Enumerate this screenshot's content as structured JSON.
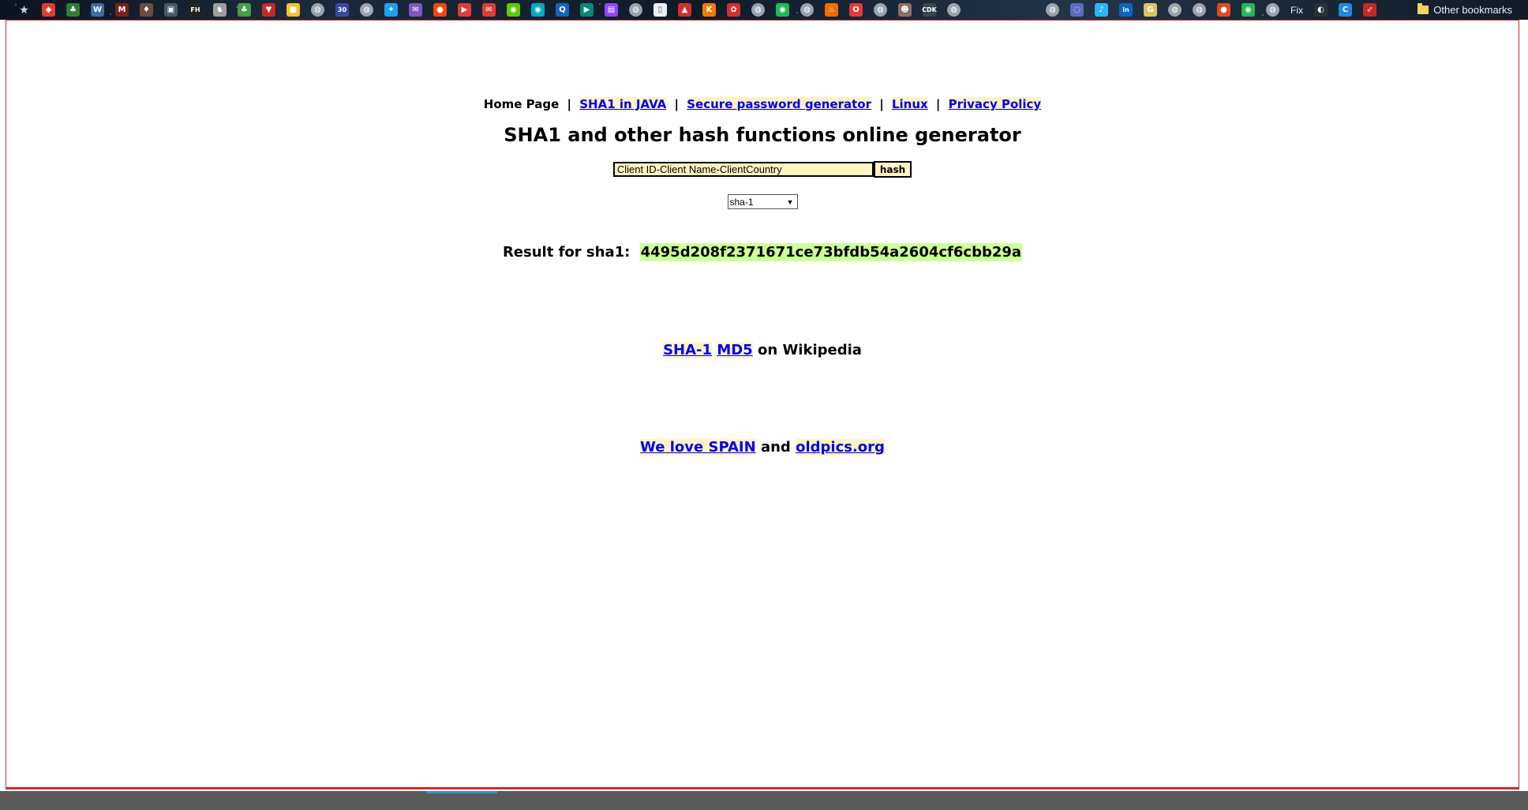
{
  "bookmarks_bar": {
    "icons": [
      {
        "name": "bookmark-star-icon",
        "color": "#cfd6df",
        "glyph": "★"
      },
      {
        "name": "pill-icon",
        "color": "#e53935",
        "glyph": "◆"
      },
      {
        "name": "clover-icon",
        "color": "#2e7d32",
        "glyph": "♣"
      },
      {
        "name": "wordpress-icon",
        "color": "#3b6ea5",
        "glyph": "W"
      },
      {
        "name": "mx-icon",
        "color": "#7b1f1f",
        "glyph": "M"
      },
      {
        "name": "fire-icon",
        "color": "#6d4c41",
        "glyph": "♦"
      },
      {
        "name": "book-icon",
        "color": "#455a64",
        "glyph": "▣"
      },
      {
        "name": "fh-icon",
        "color": "#222",
        "glyph": "FH"
      },
      {
        "name": "horse-icon",
        "color": "#9e9e9e",
        "glyph": "♞"
      },
      {
        "name": "leaf-icon",
        "color": "#43a047",
        "glyph": "♣"
      },
      {
        "name": "shield-icon",
        "color": "#c62828",
        "glyph": "▼"
      },
      {
        "name": "notes-icon",
        "color": "#fbc02d",
        "glyph": "■"
      },
      {
        "name": "globe-icon",
        "color": "#9aa3ad",
        "glyph": "◍"
      },
      {
        "name": "calendar-icon",
        "color": "#3949ab",
        "glyph": "30"
      },
      {
        "name": "globe-icon",
        "color": "#9aa3ad",
        "glyph": "◍"
      },
      {
        "name": "twitter-icon",
        "color": "#1da1f2",
        "glyph": "✦"
      },
      {
        "name": "messenger-icon",
        "color": "#7e57c2",
        "glyph": "✉"
      },
      {
        "name": "reddit-icon",
        "color": "#ff4500",
        "glyph": "●"
      },
      {
        "name": "youtube-icon",
        "color": "#e53935",
        "glyph": "▶"
      },
      {
        "name": "mail-icon",
        "color": "#e53935",
        "glyph": "✉"
      },
      {
        "name": "duolingo-icon",
        "color": "#58cc02",
        "glyph": "◉"
      },
      {
        "name": "app-icon",
        "color": "#00acc1",
        "glyph": "◉"
      },
      {
        "name": "quora-icon",
        "color": "#1565c0",
        "glyph": "Q"
      },
      {
        "name": "play-icon",
        "color": "#00897b",
        "glyph": "▶"
      },
      {
        "name": "twitch-icon",
        "color": "#9146ff",
        "glyph": "▤"
      },
      {
        "name": "globe-icon",
        "color": "#9aa3ad",
        "glyph": "◍"
      },
      {
        "name": "page-icon",
        "color": "#eceff1",
        "glyph": "▯"
      },
      {
        "name": "triangle-icon",
        "color": "#d32f2f",
        "glyph": "▲"
      },
      {
        "name": "k-icon",
        "color": "#f57c00",
        "glyph": "K"
      },
      {
        "name": "huawei-icon",
        "color": "#d32f2f",
        "glyph": "✿"
      },
      {
        "name": "globe-icon",
        "color": "#9aa3ad",
        "glyph": "◍"
      },
      {
        "name": "spotify-icon",
        "color": "#1db954",
        "glyph": "◉"
      },
      {
        "name": "globe-icon",
        "color": "#9aa3ad",
        "glyph": "◍"
      },
      {
        "name": "flame-icon",
        "color": "#ef6c00",
        "glyph": "♨"
      },
      {
        "name": "opera-icon",
        "color": "#e53935",
        "glyph": "O"
      },
      {
        "name": "globe-icon",
        "color": "#9aa3ad",
        "glyph": "◍"
      },
      {
        "name": "avatar-icon",
        "color": "#8d6e63",
        "glyph": "☻"
      },
      {
        "name": "cdk-icon",
        "color": "#37474f",
        "glyph": "CDK"
      },
      {
        "name": "globe-icon",
        "color": "#9aa3ad",
        "glyph": "◍"
      }
    ],
    "icons_right": [
      {
        "name": "globe-icon",
        "color": "#9aa3ad",
        "glyph": "◍"
      },
      {
        "name": "loop-icon",
        "color": "#5c6bc0",
        "glyph": "◌"
      },
      {
        "name": "music-icon",
        "color": "#29b6f6",
        "glyph": "♪"
      },
      {
        "name": "linkedin-icon",
        "color": "#0a66c2",
        "glyph": "in"
      },
      {
        "name": "g-icon",
        "color": "#e0c060",
        "glyph": "G"
      },
      {
        "name": "globe-icon",
        "color": "#9aa3ad",
        "glyph": "◍"
      },
      {
        "name": "globe-icon",
        "color": "#9aa3ad",
        "glyph": "◍"
      },
      {
        "name": "apple-icon",
        "color": "#e64a19",
        "glyph": "●"
      },
      {
        "name": "spotify-icon",
        "color": "#1db954",
        "glyph": "◉"
      },
      {
        "name": "globe-icon",
        "color": "#9aa3ad",
        "glyph": "◍"
      }
    ],
    "fix_label": "Fix",
    "icons_far_right": [
      {
        "name": "dark-icon",
        "color": "#263238",
        "glyph": "◐"
      },
      {
        "name": "c-icon",
        "color": "#1e88e5",
        "glyph": "C"
      },
      {
        "name": "arrow-icon",
        "color": "#c62828",
        "glyph": "➶"
      }
    ],
    "other_bookmarks_label": "Other bookmarks"
  },
  "nav": {
    "home": "Home Page",
    "separator": "|",
    "sha1_java": "SHA1 in JAVA",
    "password_gen": "Secure password generator",
    "linux": "Linux",
    "privacy": "Privacy Policy"
  },
  "page_title": "SHA1 and other hash functions online generator",
  "form": {
    "input_value": "Client ID-Client Name-ClientCountry",
    "button_label": "hash",
    "selected_algorithm": "sha-1"
  },
  "result": {
    "label": "Result for sha1:",
    "hash": "4495d208f2371671ce73bfdb54a2604cf6cbb29a"
  },
  "wiki": {
    "sha1_link": "SHA-1",
    "md5_link": "MD5",
    "suffix": "on Wikipedia"
  },
  "footer_links": {
    "spain": "We love SPAIN",
    "and": "and",
    "oldpics": "oldpics.org"
  },
  "colors": {
    "link": "#0000ee",
    "link_highlight": "#fff3c4",
    "result_highlight": "#ccff99",
    "frame_border": "#d62828"
  }
}
